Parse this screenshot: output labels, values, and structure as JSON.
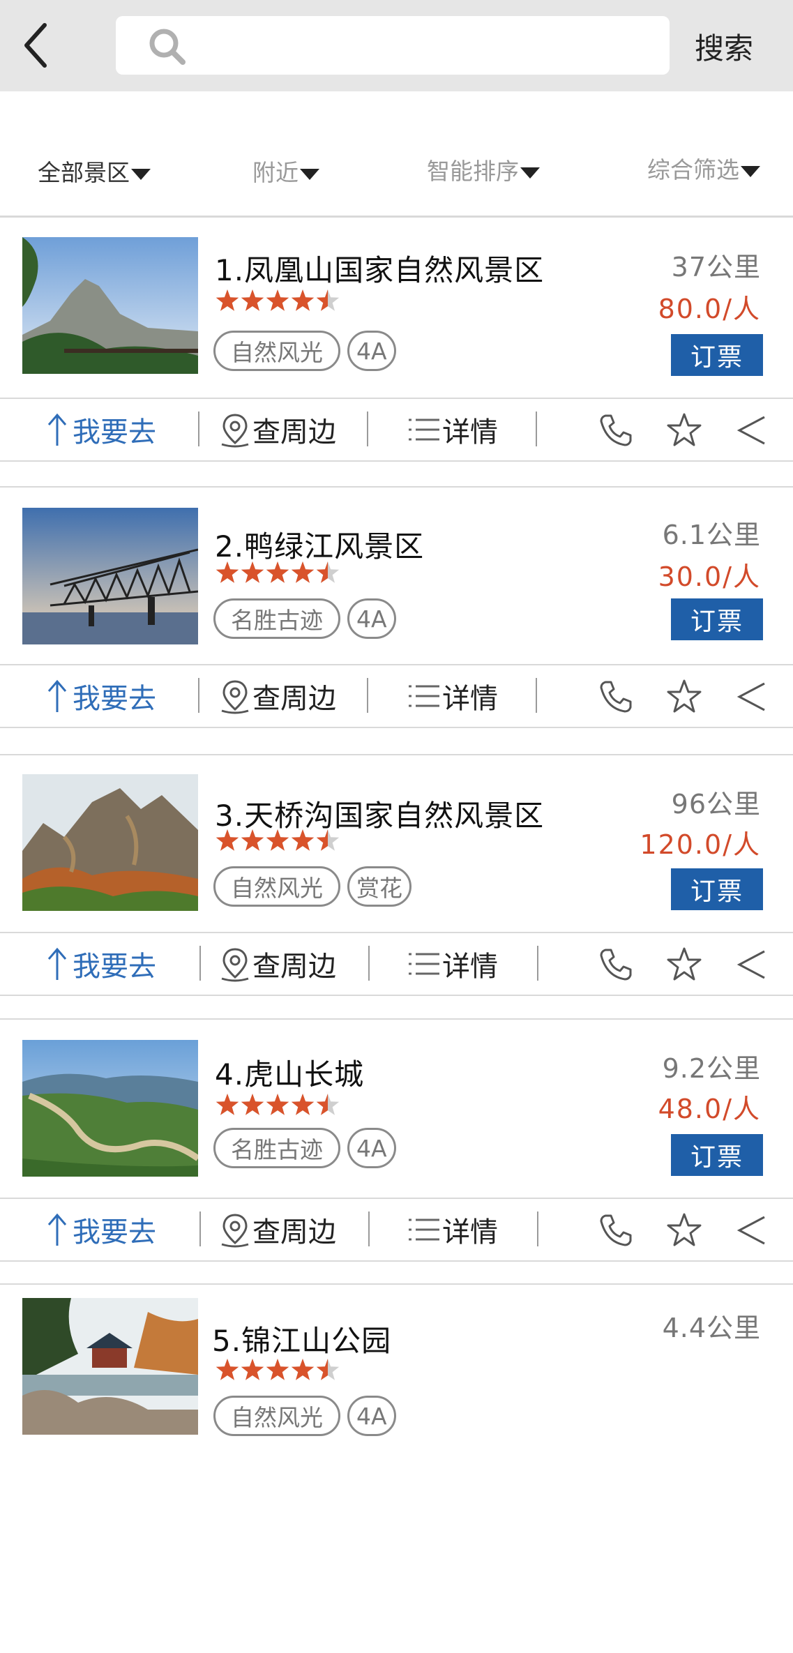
{
  "search": {
    "placeholder": "",
    "button_label": "搜索"
  },
  "filters": [
    {
      "label": "全部景区",
      "active": true
    },
    {
      "label": "附近",
      "active": false
    },
    {
      "label": "智能排序",
      "active": false
    },
    {
      "label": "综合筛选",
      "active": false
    }
  ],
  "actions": {
    "go": "我要去",
    "nearby": "查周边",
    "details": "详情"
  },
  "ticket_label": "订票",
  "colors": {
    "brand_blue": "#1f5fa8",
    "price_red": "#d24a2a",
    "star_orange": "#d9532b"
  },
  "listings": [
    {
      "name": "1.凤凰山国家自然风景区",
      "rating": 4.5,
      "tags": [
        "自然风光",
        "4A"
      ],
      "distance": "37公里",
      "price": "80.0/人",
      "image": "mountain-cliff-photo"
    },
    {
      "name": "2.鸭绿江风景区",
      "rating": 4.5,
      "tags": [
        "名胜古迹",
        "4A"
      ],
      "distance": "6.1公里",
      "price": "30.0/人",
      "image": "river-bridge-photo"
    },
    {
      "name": "3.天桥沟国家自然风景区",
      "rating": 4.5,
      "tags": [
        "自然风光",
        "赏花"
      ],
      "distance": "96公里",
      "price": "120.0/人",
      "image": "autumn-peaks-photo"
    },
    {
      "name": "4.虎山长城",
      "rating": 4.5,
      "tags": [
        "名胜古迹",
        "4A"
      ],
      "distance": "9.2公里",
      "price": "48.0/人",
      "image": "great-wall-photo"
    },
    {
      "name": "5.锦江山公园",
      "rating": 4.5,
      "tags": [
        "自然风光",
        "4A"
      ],
      "distance": "4.4公里",
      "price": "",
      "image": "park-pavilion-photo"
    }
  ]
}
